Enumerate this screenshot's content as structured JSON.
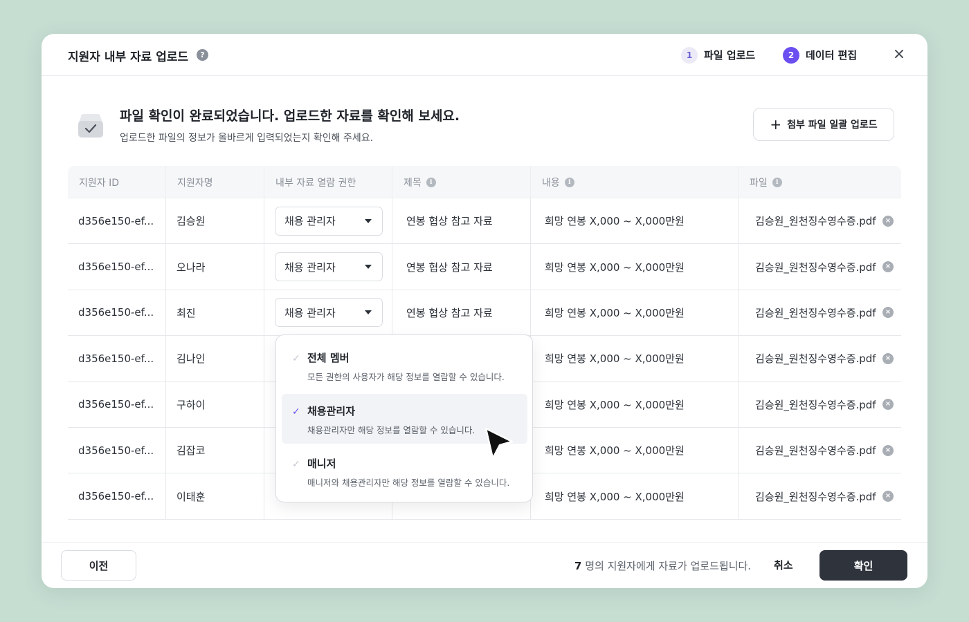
{
  "header": {
    "title": "지원자 내부 자료 업로드",
    "help_icon": "?",
    "steps": [
      {
        "num": "1",
        "label": "파일 업로드"
      },
      {
        "num": "2",
        "label": "데이터 편집"
      }
    ],
    "close_icon": "×"
  },
  "banner": {
    "title": "파일 확인이 완료되었습니다. 업로드한 자료를 확인해 보세요.",
    "subtitle": "업로드한 파일의 정보가 올바르게 입력되었는지 확인해 주세요.",
    "bulk_upload_label": "첨부 파일 일괄 업로드",
    "plus_icon": "+"
  },
  "table": {
    "columns": [
      "지원자 ID",
      "지원자명",
      "내부 자료 열람 권한",
      "제목",
      "내용",
      "파일"
    ],
    "rows": [
      {
        "id": "d356e150-ef...",
        "name": "김승원",
        "permission": "채용 관리자",
        "title": "연봉 협상 참고 자료",
        "content": "희망 연봉 X,000 ~ X,000만원",
        "file": "김승원_원천징수영수증.pdf"
      },
      {
        "id": "d356e150-ef...",
        "name": "오나라",
        "permission": "채용 관리자",
        "title": "연봉 협상 참고 자료",
        "content": "희망 연봉 X,000 ~ X,000만원",
        "file": "김승원_원천징수영수증.pdf"
      },
      {
        "id": "d356e150-ef...",
        "name": "최진",
        "permission": "채용 관리자",
        "title": "연봉 협상 참고 자료",
        "content": "희망 연봉 X,000 ~ X,000만원",
        "file": "김승원_원천징수영수증.pdf"
      },
      {
        "id": "d356e150-ef...",
        "name": "김나인",
        "permission": "",
        "title": "",
        "content": "희망 연봉 X,000 ~ X,000만원",
        "file": "김승원_원천징수영수증.pdf"
      },
      {
        "id": "d356e150-ef...",
        "name": "구하이",
        "permission": "",
        "title": "",
        "content": "희망 연봉 X,000 ~ X,000만원",
        "file": "김승원_원천징수영수증.pdf"
      },
      {
        "id": "d356e150-ef...",
        "name": "김잡코",
        "permission": "",
        "title": "",
        "content": "희망 연봉 X,000 ~ X,000만원",
        "file": "김승원_원천징수영수증.pdf"
      },
      {
        "id": "d356e150-ef...",
        "name": "이태훈",
        "permission": "",
        "title": "",
        "content": "희망 연봉 X,000 ~ X,000만원",
        "file": "김승원_원천징수영수증.pdf"
      }
    ],
    "remove_icon": "×"
  },
  "dropdown": {
    "options": [
      {
        "title": "전체 멤버",
        "desc": "모든 권한의 사용자가 해당 정보를 열람할 수 있습니다.",
        "selected": false
      },
      {
        "title": "채용관리자",
        "desc": "채용관리자만 해당 정보를 열람할 수 있습니다.",
        "selected": true
      },
      {
        "title": "매니저",
        "desc": "매니저와 채용관리자만 해당 정보를 열람할 수 있습니다.",
        "selected": false
      }
    ],
    "check_icon": "✓"
  },
  "footer": {
    "prev_label": "이전",
    "summary_count": "7",
    "summary_text": " 명의 지원자에게 자료가 업로드됩니다.",
    "cancel_label": "취소",
    "confirm_label": "확인"
  },
  "colors": {
    "background": "#c6ddd2",
    "accent": "#6c4ff0",
    "primary_button": "#2e333c"
  }
}
